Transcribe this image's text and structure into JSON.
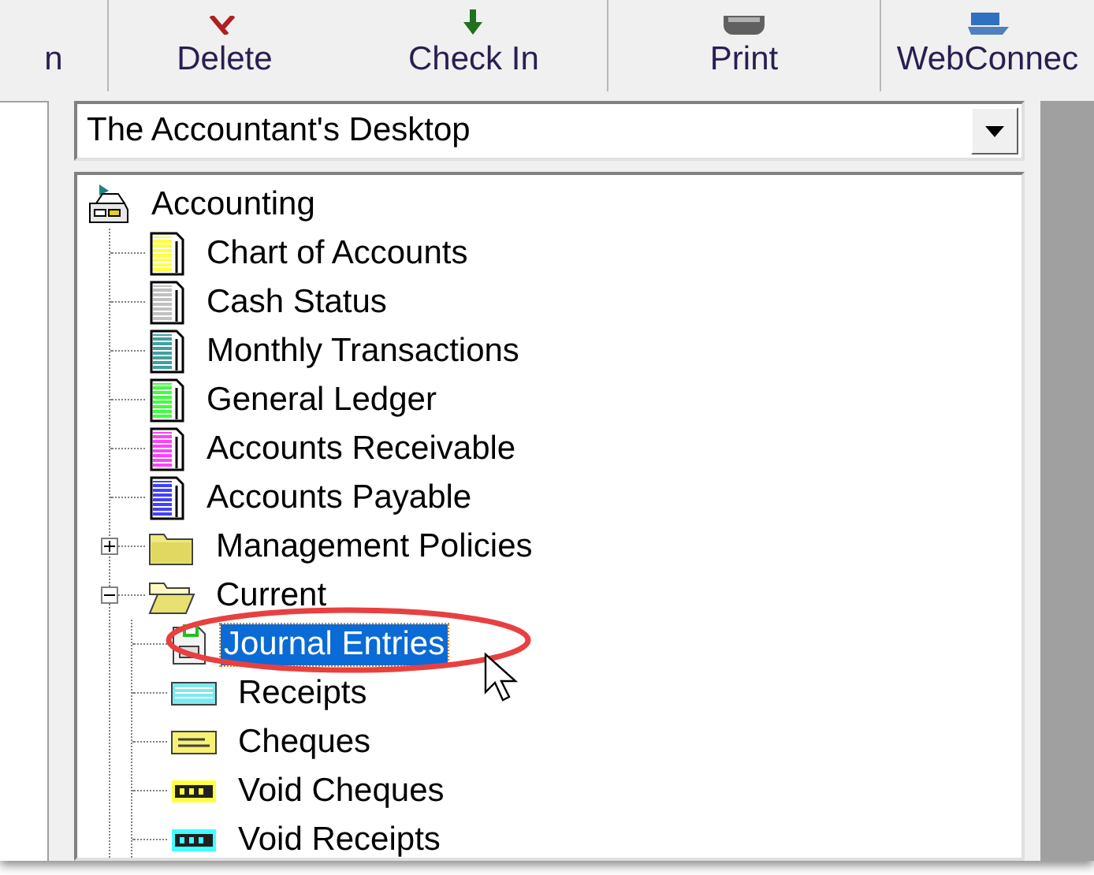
{
  "toolbar": {
    "groups": [
      [
        {
          "label": "n",
          "kind": "none"
        }
      ],
      [
        {
          "label": "Delete",
          "kind": "delete"
        },
        {
          "label": "Check In",
          "kind": "checkin"
        }
      ],
      [
        {
          "label": "Print",
          "kind": "print"
        }
      ],
      [
        {
          "label": "WebConnec",
          "kind": "web"
        }
      ]
    ]
  },
  "view_selector": {
    "value": "The Accountant's Desktop"
  },
  "tree": [
    {
      "label": "Accounting",
      "kind": "stack",
      "selected": false,
      "children": [
        {
          "label": "Chart of Accounts",
          "kind": "book",
          "color": "#ffff40",
          "selected": false
        },
        {
          "label": "Cash Status",
          "kind": "book",
          "color": "#c0c0c0",
          "selected": false
        },
        {
          "label": "Monthly Transactions",
          "kind": "book",
          "color": "#40a0a0",
          "selected": false
        },
        {
          "label": "General Ledger",
          "kind": "book",
          "color": "#40ff40",
          "selected": false
        },
        {
          "label": "Accounts Receivable",
          "kind": "book",
          "color": "#ff40ff",
          "selected": false
        },
        {
          "label": "Accounts Payable",
          "kind": "book",
          "color": "#4040ff",
          "selected": false
        },
        {
          "label": "Management Policies",
          "kind": "folder",
          "expanded": false,
          "selected": false
        },
        {
          "label": "Current",
          "kind": "folder",
          "expanded": true,
          "selected": false,
          "children": [
            {
              "label": "Journal Entries",
              "kind": "journal",
              "selected": true
            },
            {
              "label": "Receipts",
              "kind": "receipt",
              "selected": false
            },
            {
              "label": "Cheques",
              "kind": "cheque",
              "selected": false
            },
            {
              "label": "Void Cheques",
              "kind": "void",
              "color": "#ffff40",
              "selected": false
            },
            {
              "label": "Void Receipts",
              "kind": "void",
              "color": "#40ffff",
              "selected": false
            }
          ]
        }
      ]
    }
  ]
}
